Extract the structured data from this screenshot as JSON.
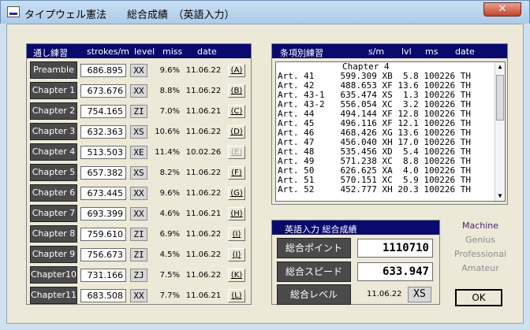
{
  "window": {
    "title": "タイプウェル憲法　　総合成績　（英語入力）",
    "close_label": "✕"
  },
  "practice": {
    "headers": {
      "title": "通し練習",
      "strokes": "strokes/m",
      "level": "level",
      "miss": "miss",
      "date": "date"
    },
    "rows": [
      {
        "name": "Preamble",
        "sm": "686.895",
        "level": "XX",
        "miss": "9.6%",
        "date": "11.06.22",
        "link": "(A)",
        "disabled": false
      },
      {
        "name": "Chapter 1",
        "sm": "673.676",
        "level": "XX",
        "miss": "8.8%",
        "date": "11.06.22",
        "link": "(B)",
        "disabled": false
      },
      {
        "name": "Chapter 2",
        "sm": "754.165",
        "level": "ZI",
        "miss": "7.0%",
        "date": "11.06.21",
        "link": "(C)",
        "disabled": false
      },
      {
        "name": "Chapter 3",
        "sm": "632.363",
        "level": "XS",
        "miss": "10.6%",
        "date": "11.06.22",
        "link": "(D)",
        "disabled": false
      },
      {
        "name": "Chapter 4",
        "sm": "513.503",
        "level": "XE",
        "miss": "11.4%",
        "date": "10.02.26",
        "link": "(E)",
        "disabled": true
      },
      {
        "name": "Chapter 5",
        "sm": "657.382",
        "level": "XS",
        "miss": "8.2%",
        "date": "11.06.22",
        "link": "(F)",
        "disabled": false
      },
      {
        "name": "Chapter 6",
        "sm": "673.445",
        "level": "XX",
        "miss": "9.6%",
        "date": "11.06.22",
        "link": "(G)",
        "disabled": false
      },
      {
        "name": "Chapter 7",
        "sm": "693.399",
        "level": "XX",
        "miss": "4.6%",
        "date": "11.06.21",
        "link": "(H)",
        "disabled": false
      },
      {
        "name": "Chapter 8",
        "sm": "759.610",
        "level": "ZI",
        "miss": "6.9%",
        "date": "11.06.22",
        "link": "(I)",
        "disabled": false
      },
      {
        "name": "Chapter 9",
        "sm": "756.673",
        "level": "ZI",
        "miss": "4.5%",
        "date": "11.06.22",
        "link": "(J)",
        "disabled": false
      },
      {
        "name": "Chapter10",
        "sm": "731.166",
        "level": "ZJ",
        "miss": "7.5%",
        "date": "11.06.22",
        "link": "(K)",
        "disabled": false
      },
      {
        "name": "Chapter11",
        "sm": "683.508",
        "level": "XX",
        "miss": "7.7%",
        "date": "11.06.21",
        "link": "(L)",
        "disabled": false
      }
    ]
  },
  "articles": {
    "headers": {
      "title": "条項別練習",
      "sm": "s/m",
      "lvl": "lvl",
      "ms": "ms",
      "date": "date"
    },
    "chapter_heading": "Chapter 4",
    "rows": [
      "Art. 41     599.309 XB  5.8 100226 TH",
      "Art. 42     488.653 XF 13.6 100226 TH",
      "Art. 43-1   635.474 XS  1.3 100226 TH",
      "Art. 43-2   556.054 XC  3.2 100226 TH",
      "Art. 44     494.144 XF 12.8 100226 TH",
      "Art. 45     496.116 XF 12.1 100226 TH",
      "Art. 46     468.426 XG 13.6 100226 TH",
      "Art. 47     456.040 XH 17.0 100226 TH",
      "Art. 48     535.456 XD  5.4 100226 TH",
      "Art. 49     571.238 XC  8.8 100226 TH",
      "Art. 50     626.625 XA  4.0 100226 TH",
      "Art. 51     570.151 XC  5.9 100226 TH",
      "Art. 52     452.777 XH 20.3 100226 TH"
    ],
    "scroll_up": "▲",
    "scroll_down": "▼"
  },
  "summary": {
    "title": "英語入力  総合成績",
    "points_label": "総合ポイント",
    "points_value": "1110710",
    "speed_label": "総合スピード",
    "speed_value": "633.947",
    "level_label": "総合レベル",
    "level_date": "11.06.22",
    "level_value": "XS"
  },
  "levels": {
    "options": [
      "Machine",
      "Genius",
      "Professional",
      "Amateur"
    ],
    "active_color": "#4b1d6e",
    "inactive_color": "#8c8c8c"
  },
  "ok_label": "OK"
}
